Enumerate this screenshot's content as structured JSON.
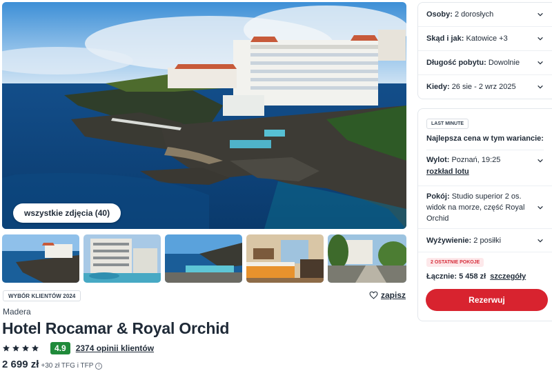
{
  "gallery": {
    "all_photos_label": "wszystkie zdjęcia (40)",
    "thumbnails": [
      "hotel-cliff-aerial",
      "hotel-building-pool",
      "ocean-pool",
      "hotel-room",
      "hotel-garden-path"
    ]
  },
  "hotel": {
    "customer_choice_badge": "WYBÓR KLIENTÓW 2024",
    "save_label": "zapisz",
    "region": "Madera",
    "name": "Hotel Rocamar & Royal Orchid",
    "stars": 4,
    "score": "4.9",
    "reviews_label": "2374 opinii klientów",
    "price": "2 699 zł",
    "price_extra": "+30 zł TFG i TFP"
  },
  "filters": [
    {
      "label": "Osoby:",
      "value": "2 dorosłych"
    },
    {
      "label": "Skąd i jak:",
      "value": "Katowice +3"
    },
    {
      "label": "Długość pobytu:",
      "value": "Dowolnie"
    },
    {
      "label": "Kiedy:",
      "value": "26 sie - 2 wrz 2025"
    }
  ],
  "offer": {
    "badge": "LAST MINUTE",
    "best_price_label": "Najlepsza cena w tym wariancie:",
    "flight_label": "Wylot:",
    "flight_value": "Poznań, 19:25",
    "flight_schedule_link": "rozkład lotu",
    "room_label": "Pokój:",
    "room_value": "Studio superior 2 os. widok na morze, część Royal Orchid",
    "board_label": "Wyżywienie:",
    "board_value": "2 posiłki",
    "rooms_left_badge": "2 OSTATNIE POKOJE",
    "total_label": "Łącznie:",
    "total_value": "5 458 zł",
    "details_link": "szczegóły",
    "reserve_label": "Rezerwuj"
  },
  "colors": {
    "accent_red": "#d8232f",
    "score_green": "#1f8a3a"
  }
}
